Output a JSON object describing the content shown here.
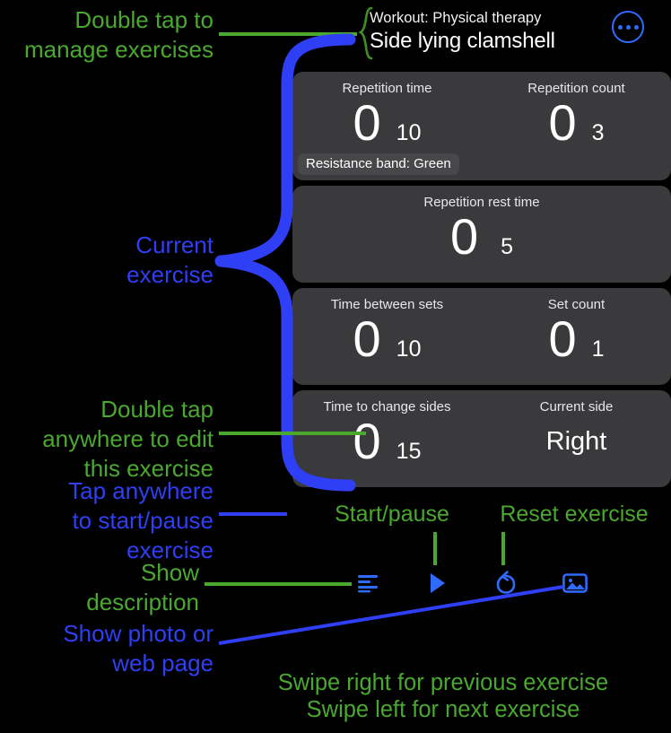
{
  "app": {
    "header": {
      "workout_label": "Workout: Physical therapy",
      "exercise_name": "Side lying clamshell",
      "more_icon": "ellipsis-circle-icon"
    },
    "cards": [
      {
        "name": "repetition-card",
        "columns": [
          {
            "label": "Repetition time",
            "value": "0",
            "target": "10"
          },
          {
            "label": "Repetition count",
            "value": "0",
            "target": "3"
          }
        ],
        "badge": "Resistance band: Green"
      },
      {
        "name": "repetition-rest-card",
        "columns": [
          {
            "label": "Repetition rest time",
            "value": "0",
            "target": "5"
          }
        ]
      },
      {
        "name": "sets-card",
        "columns": [
          {
            "label": "Time between sets",
            "value": "0",
            "target": "10"
          },
          {
            "label": "Set count",
            "value": "0",
            "target": "1"
          }
        ]
      },
      {
        "name": "sides-card",
        "columns": [
          {
            "label": "Time to change sides",
            "value": "0",
            "target": "15"
          },
          {
            "label": "Current side",
            "text": "Right"
          }
        ]
      }
    ],
    "toolbar": [
      {
        "name": "description-button",
        "icon": "description-lines-icon"
      },
      {
        "name": "play-button",
        "icon": "play-triangle-icon"
      },
      {
        "name": "reset-button",
        "icon": "reset-arrow-icon"
      },
      {
        "name": "photo-button",
        "icon": "photo-image-icon"
      }
    ]
  },
  "annotations": {
    "manage_exercises": "Double tap to\nmanage exercises",
    "current_exercise": "Current\nexercise",
    "edit_exercise": "Double tap\nanywhere to edit\nthis exercise",
    "start_pause": "Tap anywhere\nto start/pause\nexercise",
    "show_description": "Show\ndescription",
    "show_photo": "Show photo or\nweb page",
    "tool_start_pause": "Start/pause",
    "tool_reset": "Reset exercise",
    "swipe": "Swipe right for previous exercise\nSwipe left for next exercise"
  },
  "colors": {
    "background": "#000000",
    "card": "#3a3a3c",
    "badge": "#48484a",
    "annotation_green": "#4aa82e",
    "annotation_blue": "#2f3ff5",
    "accent_blue": "#2f6bff"
  }
}
